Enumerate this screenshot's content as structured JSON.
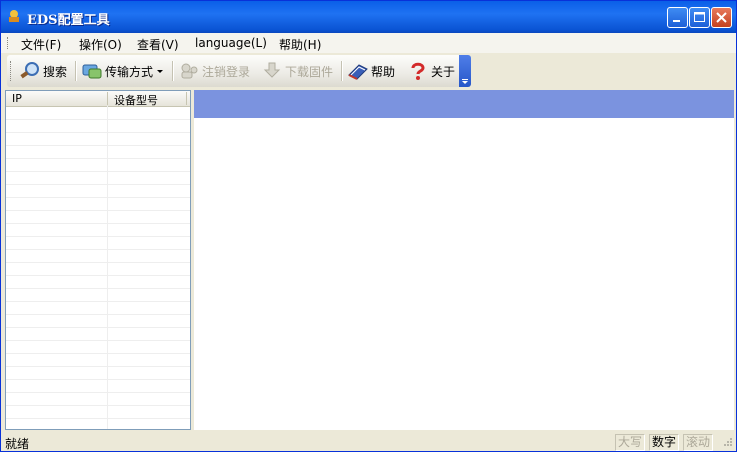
{
  "window": {
    "title": "EDS配置工具"
  },
  "menu": {
    "items": [
      {
        "label": "文件(F)"
      },
      {
        "label": "操作(O)"
      },
      {
        "label": "查看(V)"
      },
      {
        "label": "language(L)"
      },
      {
        "label": "帮助(H)"
      }
    ]
  },
  "toolbar": {
    "search": "搜索",
    "transfer": "传输方式",
    "logout": "注销登录",
    "download": "下载固件",
    "help": "帮助",
    "about": "关于"
  },
  "device_list": {
    "columns": [
      "IP",
      "设备型号"
    ],
    "rows": []
  },
  "status": {
    "text": "就绪",
    "caps": "大写",
    "num": "数字",
    "scroll": "滚动"
  },
  "colors": {
    "titlebar": "#0a5fe8",
    "panel_header": "#7b93df"
  }
}
